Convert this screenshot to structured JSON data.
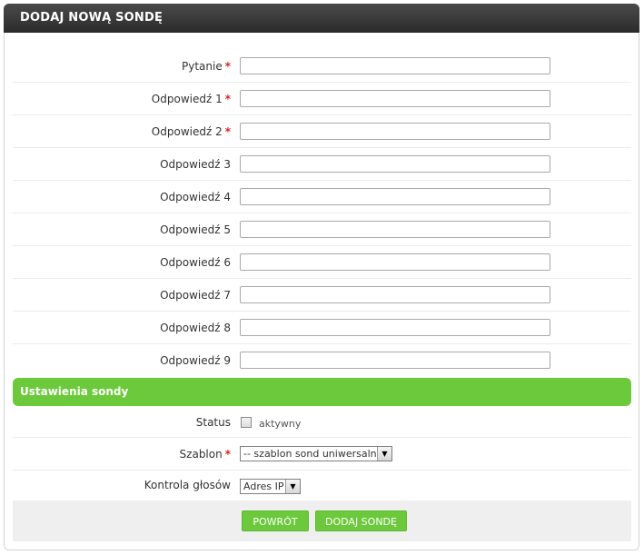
{
  "form": {
    "title": "DODAJ NOWĄ SONDĘ",
    "fields": [
      {
        "label": "Pytanie",
        "required": "*",
        "value": ""
      },
      {
        "label": "Odpowiedź 1",
        "required": "*",
        "value": ""
      },
      {
        "label": "Odpowiedź 2",
        "required": "*",
        "value": ""
      },
      {
        "label": "Odpowiedź 3",
        "required": "",
        "value": ""
      },
      {
        "label": "Odpowiedź 4",
        "required": "",
        "value": ""
      },
      {
        "label": "Odpowiedź 5",
        "required": "",
        "value": ""
      },
      {
        "label": "Odpowiedź 6",
        "required": "",
        "value": ""
      },
      {
        "label": "Odpowiedź 7",
        "required": "",
        "value": ""
      },
      {
        "label": "Odpowiedź 8",
        "required": "",
        "value": ""
      },
      {
        "label": "Odpowiedź 9",
        "required": "",
        "value": ""
      }
    ]
  },
  "settings": {
    "title": "Ustawienia sondy",
    "status": {
      "label": "Status",
      "checkbox_label": "aktywny",
      "checked": false
    },
    "template": {
      "label": "Szablon",
      "required": "*",
      "selected": "-- szablon sond uniwersalny"
    },
    "vote_control": {
      "label": "Kontrola głosów",
      "selected": "Adres IP"
    }
  },
  "buttons": {
    "back": "POWRÓT",
    "add": "DODAJ SONDĘ"
  },
  "colors": {
    "header_bg": "#333333",
    "accent_green": "#6cc93c",
    "required_red": "#d9261c"
  },
  "icons": {
    "dropdown": "chevron-down-icon"
  }
}
